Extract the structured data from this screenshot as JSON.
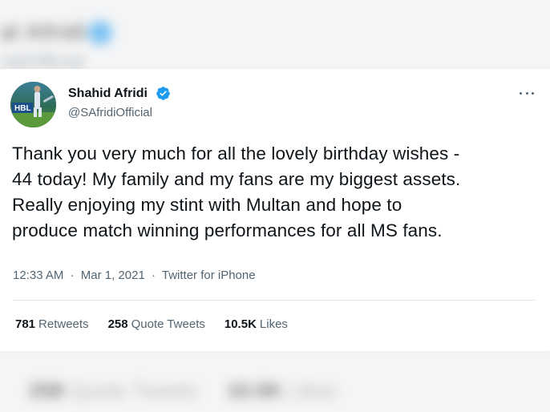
{
  "tweet": {
    "author_name": "Shahid Afridi",
    "author_handle": "@SAfridiOfficial",
    "text_lines": [
      "Thank you very much for all the lovely birthday wishes -",
      "44 today! My family and my fans are my biggest assets.",
      "Really enjoying my stint with Multan and hope to",
      "produce match winning performances for all MS fans."
    ],
    "time": "12:33 AM",
    "date": "Mar 1, 2021",
    "source": "Twitter for iPhone",
    "meta_separator": "·"
  },
  "stats": {
    "retweets_count": "781",
    "retweets_label": "Retweets",
    "quote_count": "258",
    "quote_label": "Quote Tweets",
    "likes_count": "10.5K",
    "likes_label": "Likes"
  },
  "background_echo": {
    "name_fragment": "al Afridi",
    "handle_fragment": "ridiOfficial",
    "quote_count": "258",
    "quote_label": "Quote Tweets",
    "likes_count": "10.5K",
    "likes_label": "Likes"
  },
  "colors": {
    "verified_blue": "#1d9bf0",
    "text_primary": "#0f1419",
    "text_secondary": "#536471"
  },
  "icons": {
    "verified": "verified-badge-icon",
    "more": "more-dots-icon"
  }
}
